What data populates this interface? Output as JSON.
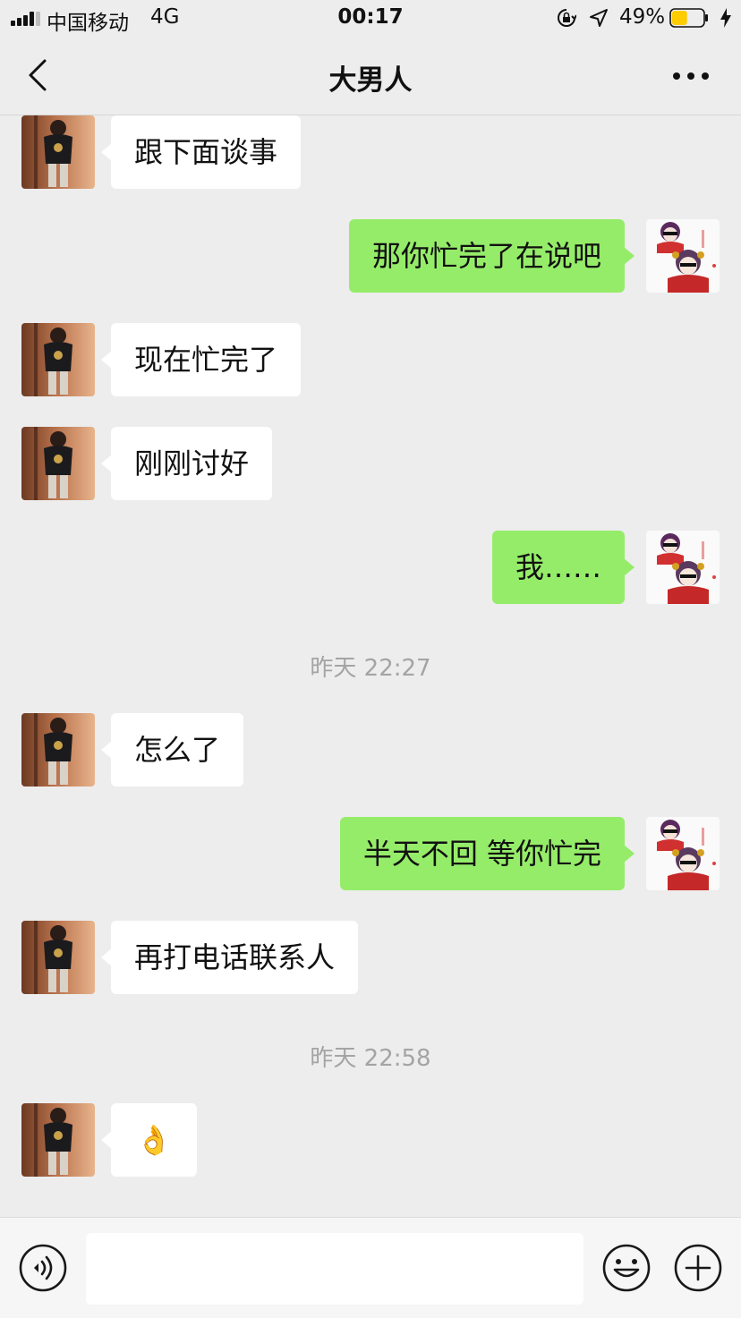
{
  "status_bar": {
    "carrier": "中国移动",
    "network": "4G",
    "time": "00:17",
    "battery_percent": "49%",
    "battery_level": 0.49,
    "battery_color": "#ffcc00",
    "icons": [
      "signal-icon",
      "orientation-lock-icon",
      "location-icon",
      "battery-icon",
      "charging-icon"
    ]
  },
  "header": {
    "title": "大男人",
    "icons": [
      "back-chevron-icon",
      "more-dots-icon"
    ]
  },
  "messages": [
    {
      "side": "left",
      "text": "跟下面谈事"
    },
    {
      "side": "right",
      "text": "那你忙完了在说吧"
    },
    {
      "side": "left",
      "text": "现在忙完了"
    },
    {
      "side": "left",
      "text": "刚刚讨好"
    },
    {
      "side": "right",
      "text": "我……"
    },
    {
      "timestamp": "昨天 22:27"
    },
    {
      "side": "left",
      "text": "怎么了"
    },
    {
      "side": "right",
      "text": "半天不回 等你忙完"
    },
    {
      "side": "left",
      "text": "再打电话联系人"
    },
    {
      "timestamp": "昨天 22:58"
    },
    {
      "side": "left",
      "text": "👌"
    }
  ],
  "input_bar": {
    "input_value": "",
    "icons": [
      "voice-icon",
      "emoji-icon",
      "plus-icon"
    ]
  },
  "colors": {
    "background": "#ededed",
    "sent_bubble": "#95ec69",
    "received_bubble": "#ffffff",
    "timestamp_text": "#a4a4a4"
  }
}
